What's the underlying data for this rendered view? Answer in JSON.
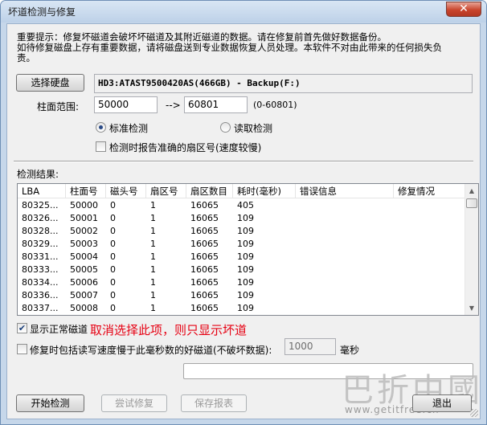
{
  "window": {
    "title": "坏道检测与修复",
    "close_symbol": "✕"
  },
  "notice": {
    "line1": "重要提示：修复坏磁道会破坏坏磁道及其附近磁道的数据。请在修复前首先做好数据备份。",
    "line2": "如待修复磁盘上存有重要数据，请将磁盘送到专业数据恢复人员处理。本软件不对由此带来的任何损失负",
    "line3": "责。"
  },
  "disk": {
    "select_label": "选择硬盘",
    "current": "HD3:ATAST9500420AS(466GB) - Backup(F:)"
  },
  "range": {
    "label": "柱面范围:",
    "from": "50000",
    "arrow": "-->",
    "to": "60801",
    "hint": "(0-60801)"
  },
  "mode": {
    "standard_label": "标准检测",
    "standard_checked": true,
    "read_label": "读取检测",
    "read_checked": false,
    "report_sector_label": "检测时报告准确的扇区号(速度较慢)",
    "report_sector_checked": false
  },
  "results": {
    "label": "检测结果:",
    "columns": [
      "LBA",
      "柱面号",
      "磁头号",
      "扇区号",
      "扇区数目",
      "耗时(毫秒)",
      "错误信息",
      "修复情况"
    ],
    "rows": [
      [
        "80325...",
        "50000",
        "0",
        "1",
        "16065",
        "405",
        "",
        ""
      ],
      [
        "80326...",
        "50001",
        "0",
        "1",
        "16065",
        "109",
        "",
        ""
      ],
      [
        "80328...",
        "50002",
        "0",
        "1",
        "16065",
        "109",
        "",
        ""
      ],
      [
        "80329...",
        "50003",
        "0",
        "1",
        "16065",
        "109",
        "",
        ""
      ],
      [
        "80331...",
        "50004",
        "0",
        "1",
        "16065",
        "109",
        "",
        ""
      ],
      [
        "80333...",
        "50005",
        "0",
        "1",
        "16065",
        "109",
        "",
        ""
      ],
      [
        "80334...",
        "50006",
        "0",
        "1",
        "16065",
        "109",
        "",
        ""
      ],
      [
        "80336...",
        "50007",
        "0",
        "1",
        "16065",
        "109",
        "",
        ""
      ],
      [
        "80337...",
        "50008",
        "0",
        "1",
        "16065",
        "109",
        "",
        ""
      ]
    ]
  },
  "options": {
    "show_normal_label": "显示正常磁道",
    "show_normal_checked": true,
    "annotation": "取消选择此项，则只显示坏道",
    "slow_read_label": "修复时包括读写速度慢于此毫秒数的好磁道(不破坏数据):",
    "slow_read_checked": false,
    "slow_read_value": "1000",
    "slow_read_unit": "毫秒"
  },
  "buttons": {
    "start": "开始检测",
    "try_repair": "尝试修复",
    "save_report": "保存报表",
    "exit": "退出"
  },
  "watermark": {
    "chars": "巴折中國",
    "url": "www.getitfree.cn"
  },
  "colors": {
    "annotation": "#e60012",
    "close_button": "#c9452d",
    "frame": "#c6d7ea"
  }
}
